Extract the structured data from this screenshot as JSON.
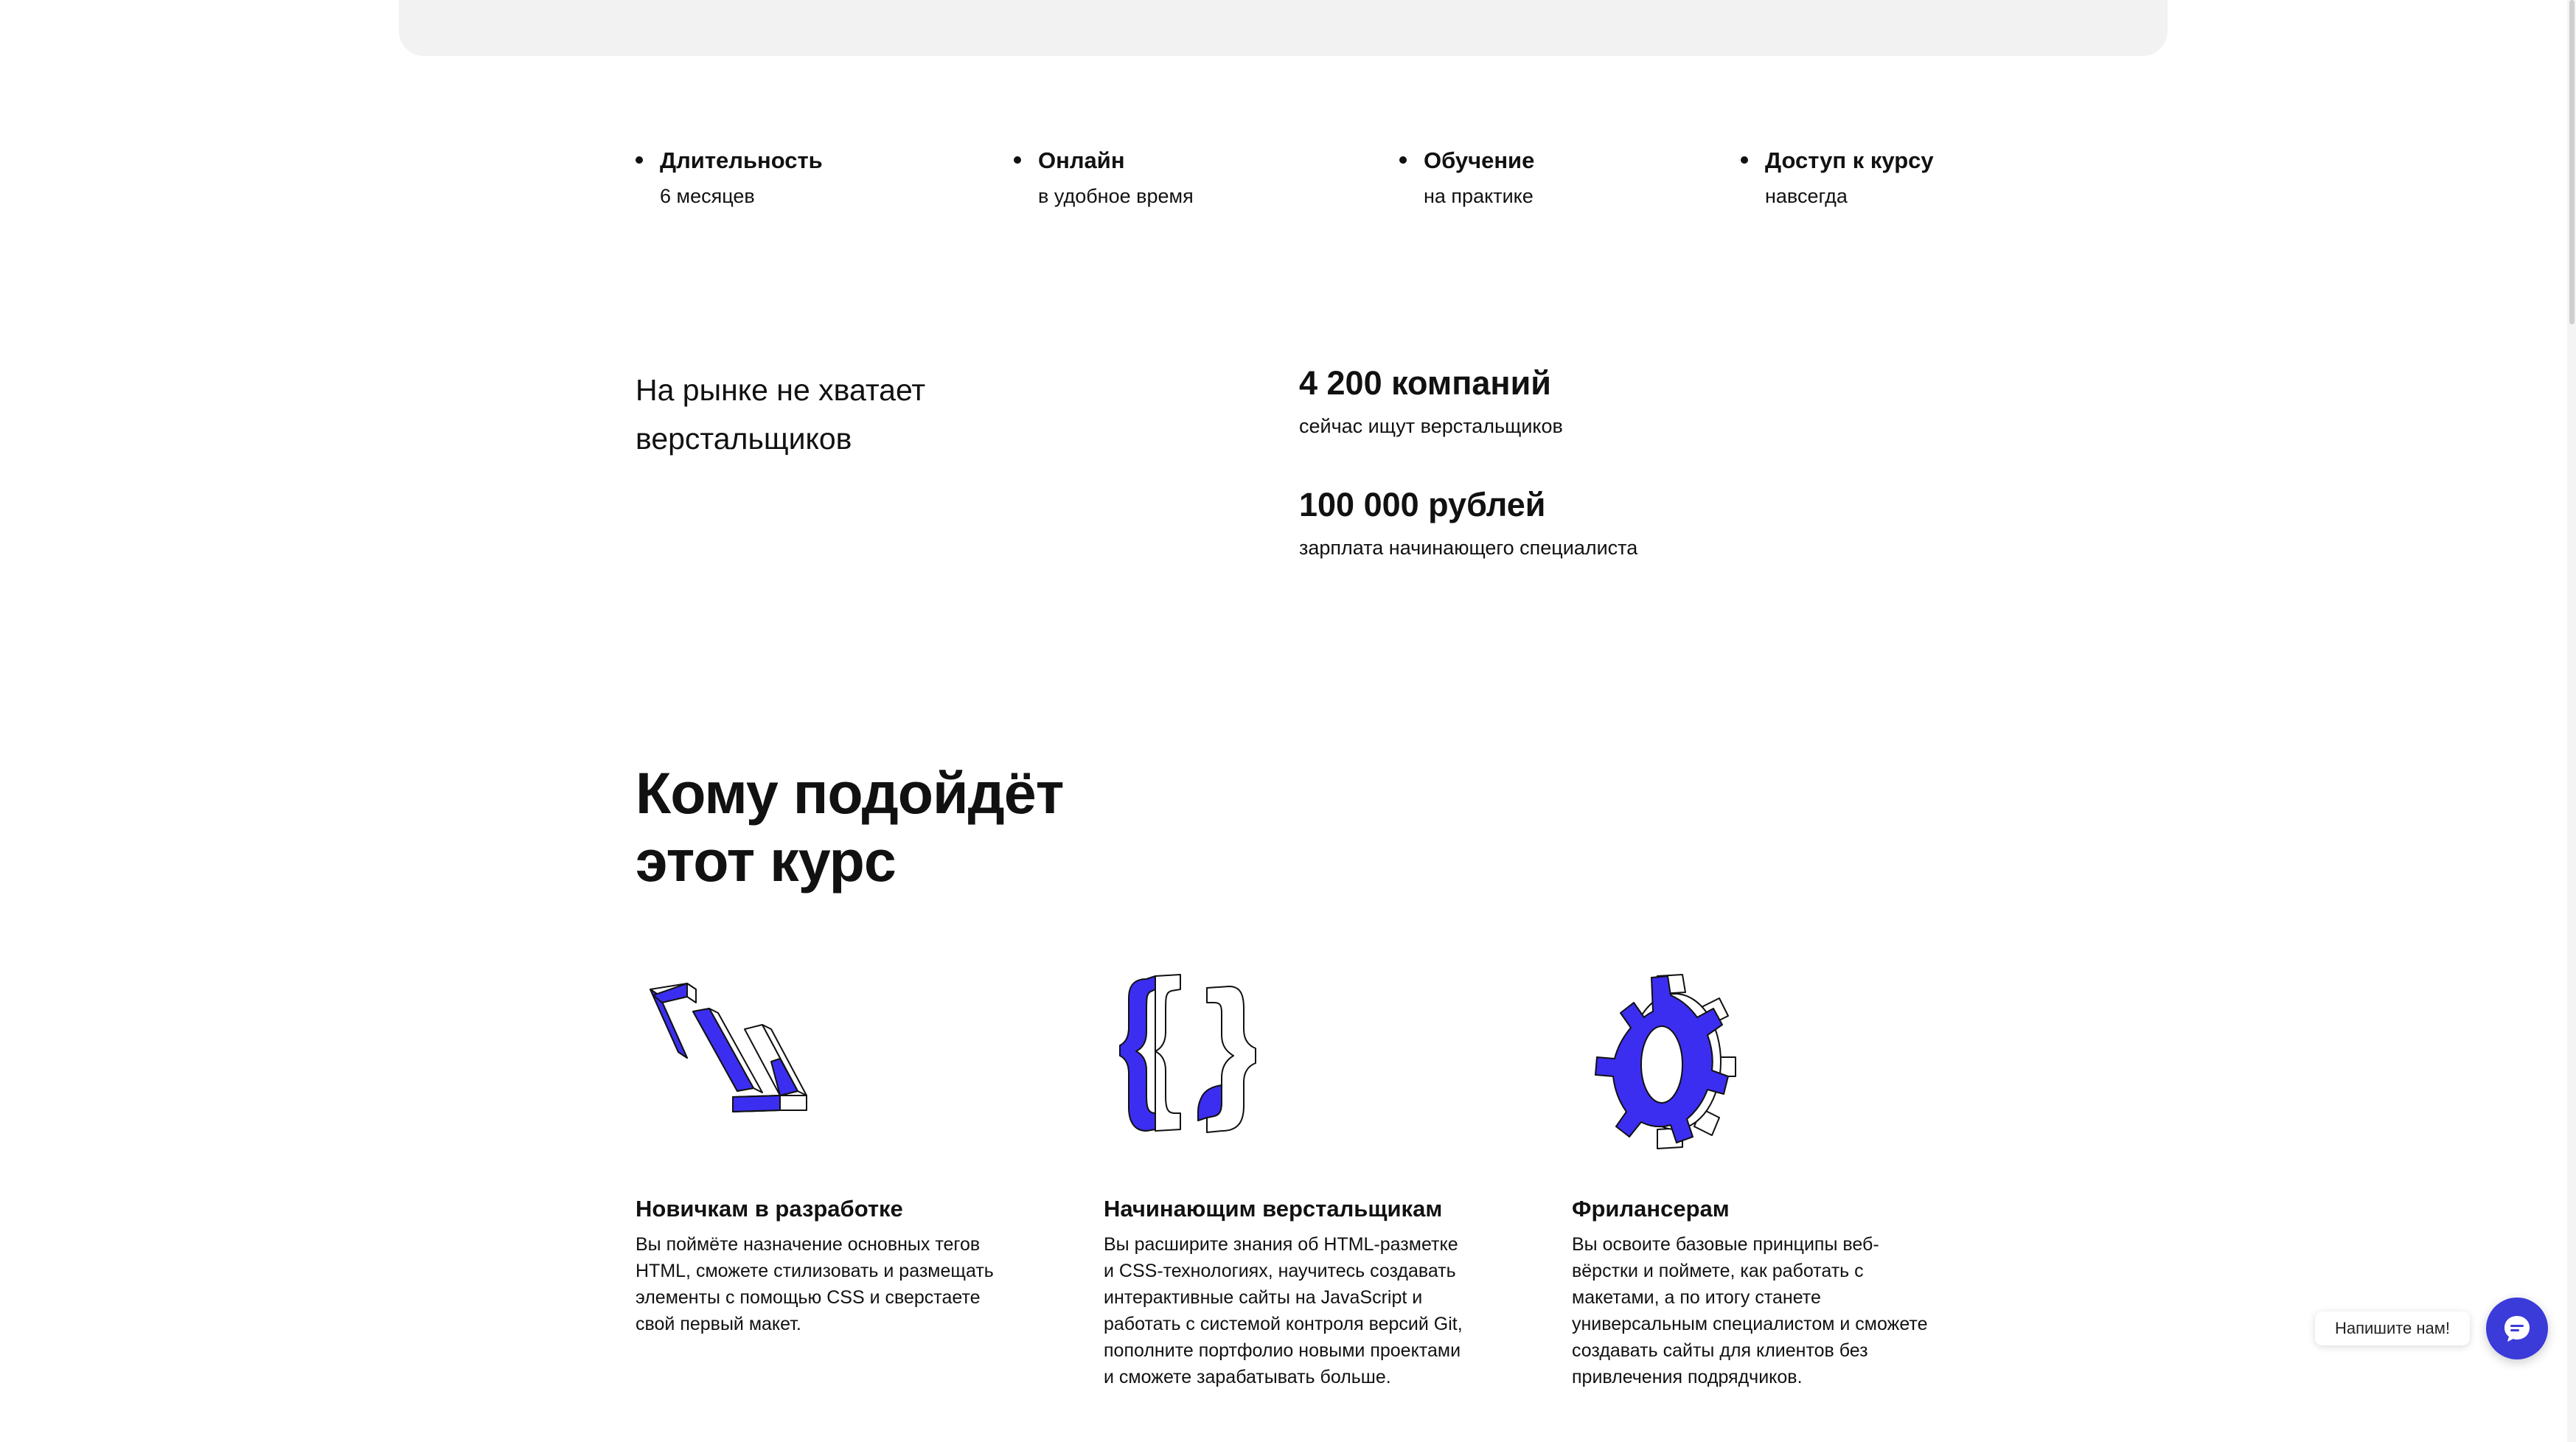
{
  "features": [
    {
      "title": "Длительность",
      "sub": "6 месяцев"
    },
    {
      "title": "Онлайн",
      "sub": "в удобное время"
    },
    {
      "title": "Обучение",
      "sub": "на практике"
    },
    {
      "title": "Доступ к курсу",
      "sub": "навсегда"
    }
  ],
  "market": {
    "title": "На рынке не хватает верстальщиков",
    "stats": [
      {
        "value": "4 200 компаний",
        "desc": "сейчас ищут верстальщиков"
      },
      {
        "value": "100 000 рублей",
        "desc": "зарплата начинающего специалиста"
      }
    ]
  },
  "audience": {
    "title_line1": "Кому подойдёт",
    "title_line2": "этот курс",
    "cards": [
      {
        "icon": "code-tag-icon",
        "title": "Новичкам в разработке",
        "desc": "Вы поймёте назначение основных тегов HTML, сможете стилизовать и размещать элементы с помощью CSS и сверстаете свой первый макет."
      },
      {
        "icon": "curly-braces-icon",
        "title": "Начинающим верстальщикам",
        "desc": "Вы расширите знания об HTML-разметке и CSS-технологиях, научитесь создавать интерактивные сайты на JavaScript и работать с системой контроля версий Git, пополните портфолио новыми проектами и сможете зарабатывать больше."
      },
      {
        "icon": "gear-icon",
        "title": "Фрилансерам",
        "desc": "Вы освоите базовые принципы веб-вёрстки и поймете, как работать с макетами, а по итогу станете универсальным специалистом и сможете создавать сайты для клиентов без привлечения подрядчиков."
      }
    ]
  },
  "chat": {
    "label": "Напишите нам!",
    "icon": "chat-bubble-icon"
  },
  "colors": {
    "accent": "#3b2ef0",
    "chat_button": "#3b3bd9",
    "banner": "#f2f2f3",
    "text": "#111111"
  }
}
